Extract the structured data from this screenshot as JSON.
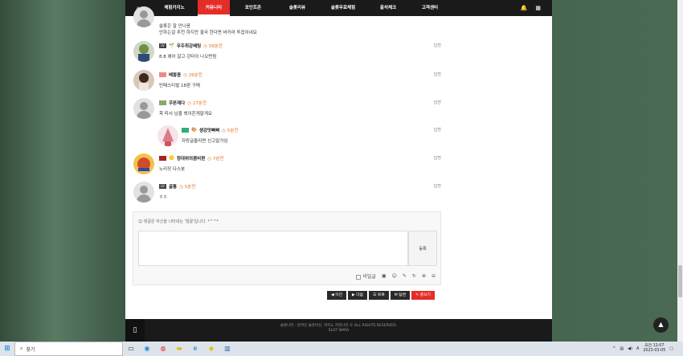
{
  "nav": {
    "items": [
      "체험카지노",
      "커뮤니티",
      "포인트존",
      "슬롯리뷰",
      "슬롯무료체험",
      "출석체크",
      "고객센터"
    ],
    "active": "커뮤니티"
  },
  "comments": [
    {
      "nickname": "",
      "level": "",
      "time": "",
      "text1": "슬롯은 잘 안나옴",
      "text": "안하는걸 추천 하지만 결국 한다면 바카라 투잡이네요",
      "reply": ""
    },
    {
      "nickname": "우주최강베팅",
      "level": "LV",
      "time": "59분전",
      "text": "8.8 헤어 갈고 강타이 나오면됨",
      "reply": "답변"
    },
    {
      "nickname": "배뽕충",
      "level": "",
      "time": "26분전",
      "text": "빈페스티벌 18판 구매",
      "reply": "답변"
    },
    {
      "nickname": "쿠폰제다",
      "level": "",
      "time": "27분전",
      "text": "목 따서 님을 뵈이쫀게말게요",
      "reply": "답변"
    },
    {
      "nickname": "생강맛빠삐",
      "level": "",
      "time": "5분전",
      "text": "자랑글올리면 신고말거임",
      "reply": "답변"
    },
    {
      "nickname": "정대위의콤비편",
      "level": "",
      "time": "7분전",
      "text": "노리잣 다스봇",
      "reply": "답변"
    },
    {
      "nickname": "골통",
      "level": "LV",
      "time": "5분전",
      "text": "ㅎㅎ",
      "reply": "답변"
    }
  ],
  "form": {
    "hint": "☺ 댓글은 자신을 나타내는 '얼굴'입니다. *^^*",
    "submit": "등록",
    "secret_label": "비밀글"
  },
  "buttons": {
    "prev": "이전",
    "next": "다음",
    "list": "목록",
    "reply": "답변",
    "write": "글쓰기"
  },
  "footer": {
    "line1": "슬롯나라 - 온라인 슬롯머신, 카지노 커뮤니티 © ALL RIGHTS RESERVED.",
    "line2": "SLOT NARA"
  },
  "taskbar": {
    "search_placeholder": "찾기",
    "time": "오전 12:07",
    "date": "2023-03-05"
  }
}
